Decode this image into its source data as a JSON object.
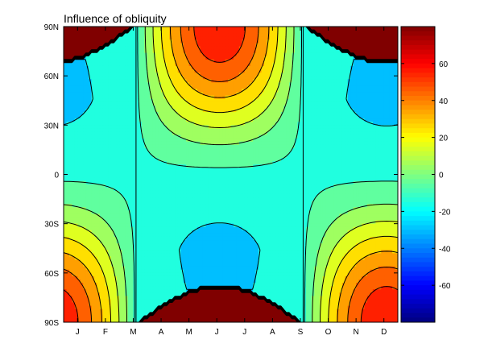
{
  "chart_data": {
    "type": "heatmap",
    "title": "Influence of obliquity",
    "xlabel": "",
    "ylabel": "",
    "x_ticks": [
      "J",
      "F",
      "M",
      "A",
      "M",
      "J",
      "J",
      "A",
      "S",
      "O",
      "N",
      "D"
    ],
    "y_ticks": [
      "90N",
      "60N",
      "30N",
      "0",
      "30S",
      "60S",
      "90S"
    ],
    "y_tick_values": [
      90,
      60,
      30,
      0,
      -30,
      -60,
      -90
    ],
    "xlim": [
      0,
      12
    ],
    "ylim": [
      -90,
      90
    ],
    "colorbar": {
      "ticks": [
        60,
        40,
        20,
        0,
        -20,
        -40,
        -60
      ],
      "range": [
        -80,
        80
      ],
      "colormap": "jet",
      "colors": [
        "#00008f",
        "#0000ff",
        "#0080ff",
        "#00ffff",
        "#80ff80",
        "#ffff00",
        "#ff8000",
        "#ff0000",
        "#800000"
      ]
    },
    "contour_levels": [
      -80,
      -60,
      -40,
      -20,
      -10,
      0,
      10,
      20,
      30,
      40,
      50,
      60,
      70,
      80
    ],
    "features": {
      "polar_night_fill_color": "#800000",
      "equinox_months": [
        2.6,
        8.6
      ],
      "summer_max_NH": {
        "month": 5.5,
        "lat": 90,
        "value": 70
      },
      "summer_max_SH": {
        "month": 11.5,
        "lat": -90,
        "value": 60
      },
      "winter_min_value": -25,
      "grid": false
    }
  }
}
